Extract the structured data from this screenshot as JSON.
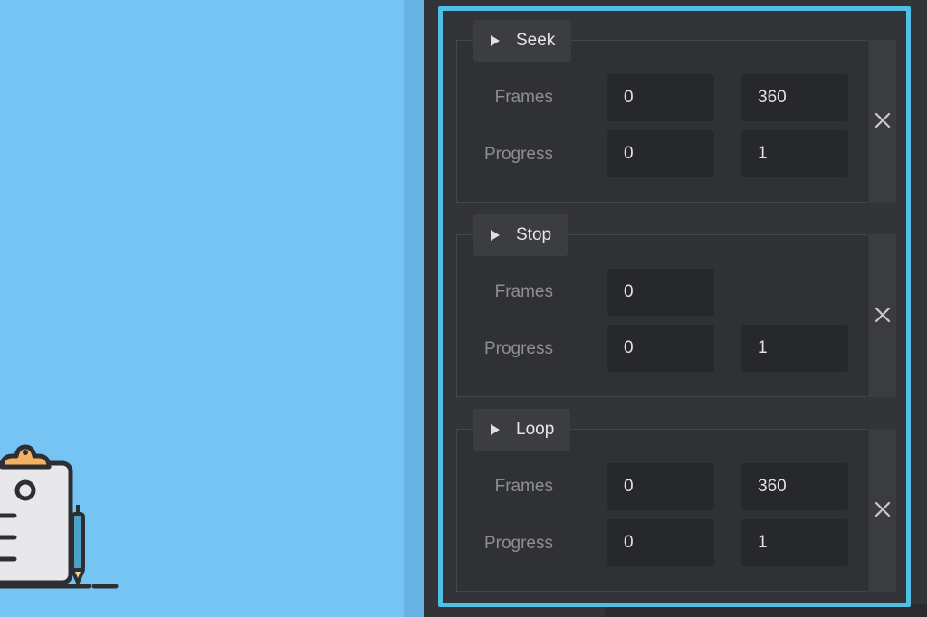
{
  "sections": [
    {
      "name": "Seek",
      "rows": [
        {
          "label": "Frames",
          "from": "0",
          "to": "360"
        },
        {
          "label": "Progress",
          "from": "0",
          "to": "1"
        }
      ]
    },
    {
      "name": "Stop",
      "rows": [
        {
          "label": "Frames",
          "from": "0",
          "to": ""
        },
        {
          "label": "Progress",
          "from": "0",
          "to": "1"
        }
      ]
    },
    {
      "name": "Loop",
      "rows": [
        {
          "label": "Frames",
          "from": "0",
          "to": "360"
        },
        {
          "label": "Progress",
          "from": "0",
          "to": "1"
        }
      ]
    }
  ],
  "icons": {
    "section_tab": "play-icon",
    "remove": "close-icon",
    "illustration": "clipboard-icon"
  },
  "colors": {
    "canvas_background": "#75c4f4",
    "panel_background": "#333438",
    "highlight_border": "#4fbfe6",
    "field_background": "#27282b"
  }
}
